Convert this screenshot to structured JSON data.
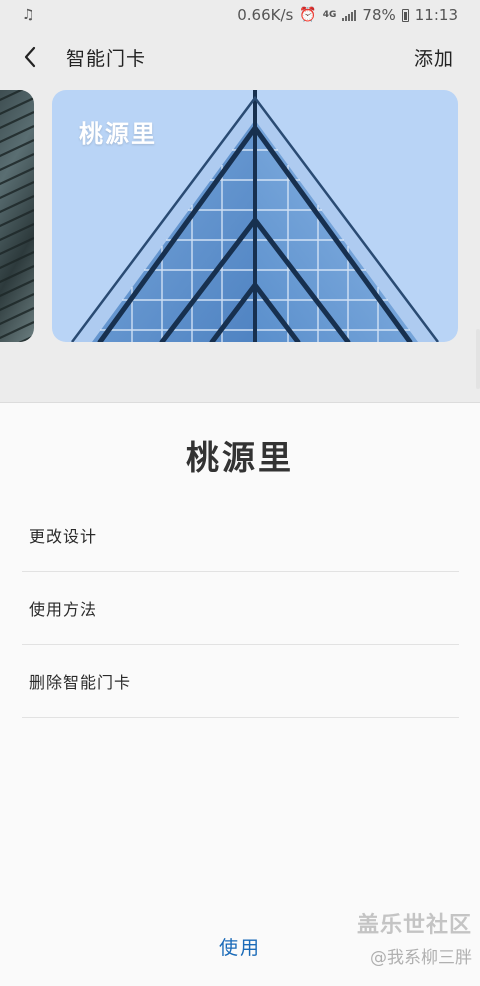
{
  "status_bar": {
    "network_speed": "0.66K/s",
    "network_type": "4G",
    "battery": "78%",
    "time": "11:13",
    "icons": [
      "notification-icon",
      "alarm-icon",
      "signal-icon",
      "battery-icon"
    ]
  },
  "app_bar": {
    "title": "智能门卡",
    "add_label": "添加",
    "back_icon": "chevron-left-icon"
  },
  "card": {
    "name": "桃源里"
  },
  "sheet": {
    "title": "桃源里",
    "menu": [
      {
        "label": "更改设计"
      },
      {
        "label": "使用方法"
      },
      {
        "label": "删除智能门卡"
      }
    ],
    "use_label": "使用"
  },
  "watermark": {
    "brand": "盖乐世社区",
    "user": "@我系柳三胖"
  },
  "colors": {
    "accent": "#1a6ab8",
    "card_sky": "#b9d4f6",
    "background": "#ececec"
  }
}
